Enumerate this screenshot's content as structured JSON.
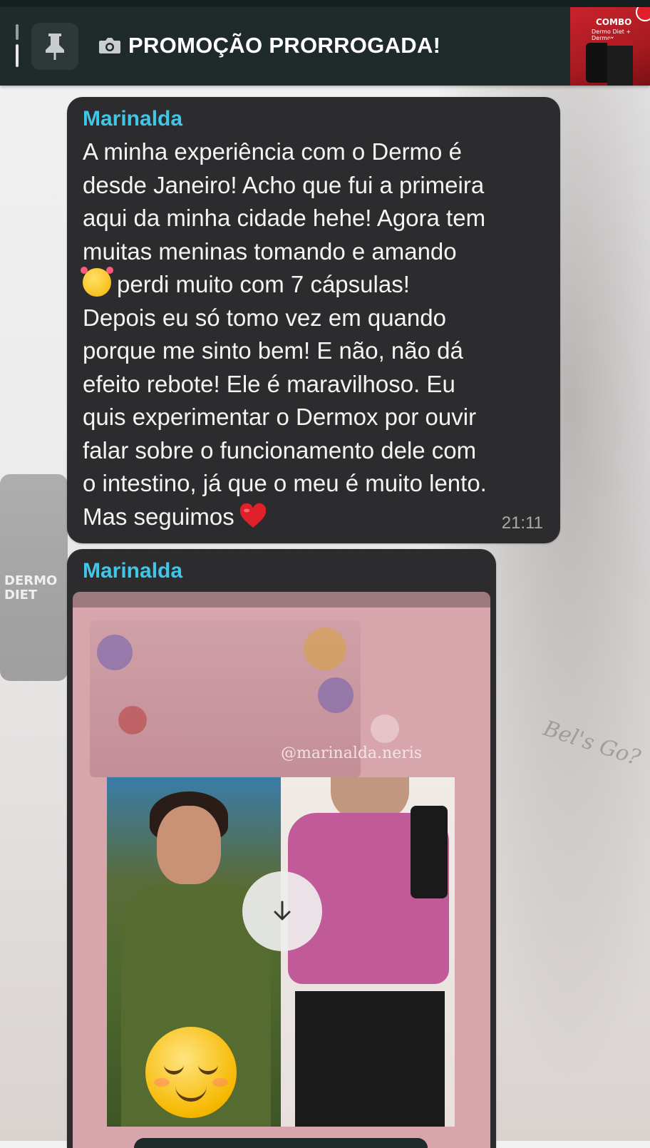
{
  "pinned": {
    "title": "PROMOÇÃO PRORROGADA!",
    "icon": "camera-icon",
    "thumbnail_title": "COMBO",
    "thumbnail_subtitle": "Dermo Diet + Dermox"
  },
  "messages": [
    {
      "sender": "Marinalda",
      "lines": [
        "A minha experiência com o Dermo é",
        "desde Janeiro! Acho que fui a primeira",
        "aqui da minha cidade hehe! Agora tem",
        "muitas meninas tomando e amando",
        "perdi muito com 7 cápsulas!",
        "Depois eu só tomo vez em quando",
        "porque me sinto bem! E não, não dá",
        "efeito rebote! Ele é maravilhoso. Eu",
        "quis experimentar o Dermox por ouvir",
        "falar sobre o funcionamento dele com",
        "o intestino, já que o meu é muito lento.",
        "Mas seguimos"
      ],
      "emoji_line5": "smiling-face-with-hearts",
      "emoji_end": "red-heart",
      "time": "21:11"
    },
    {
      "sender": "Marinalda",
      "media_type": "image",
      "media_handle": "@marinalda.neris",
      "action_icon": "download-icon"
    }
  ],
  "background": {
    "jar_text": "DERMO DIET",
    "tattoo_text": "Bel's Go?"
  },
  "colors": {
    "sender": "#40c6e6",
    "bubble": "#2c2c2e",
    "header": "#1f2a2a",
    "heart": "#e0202a"
  }
}
